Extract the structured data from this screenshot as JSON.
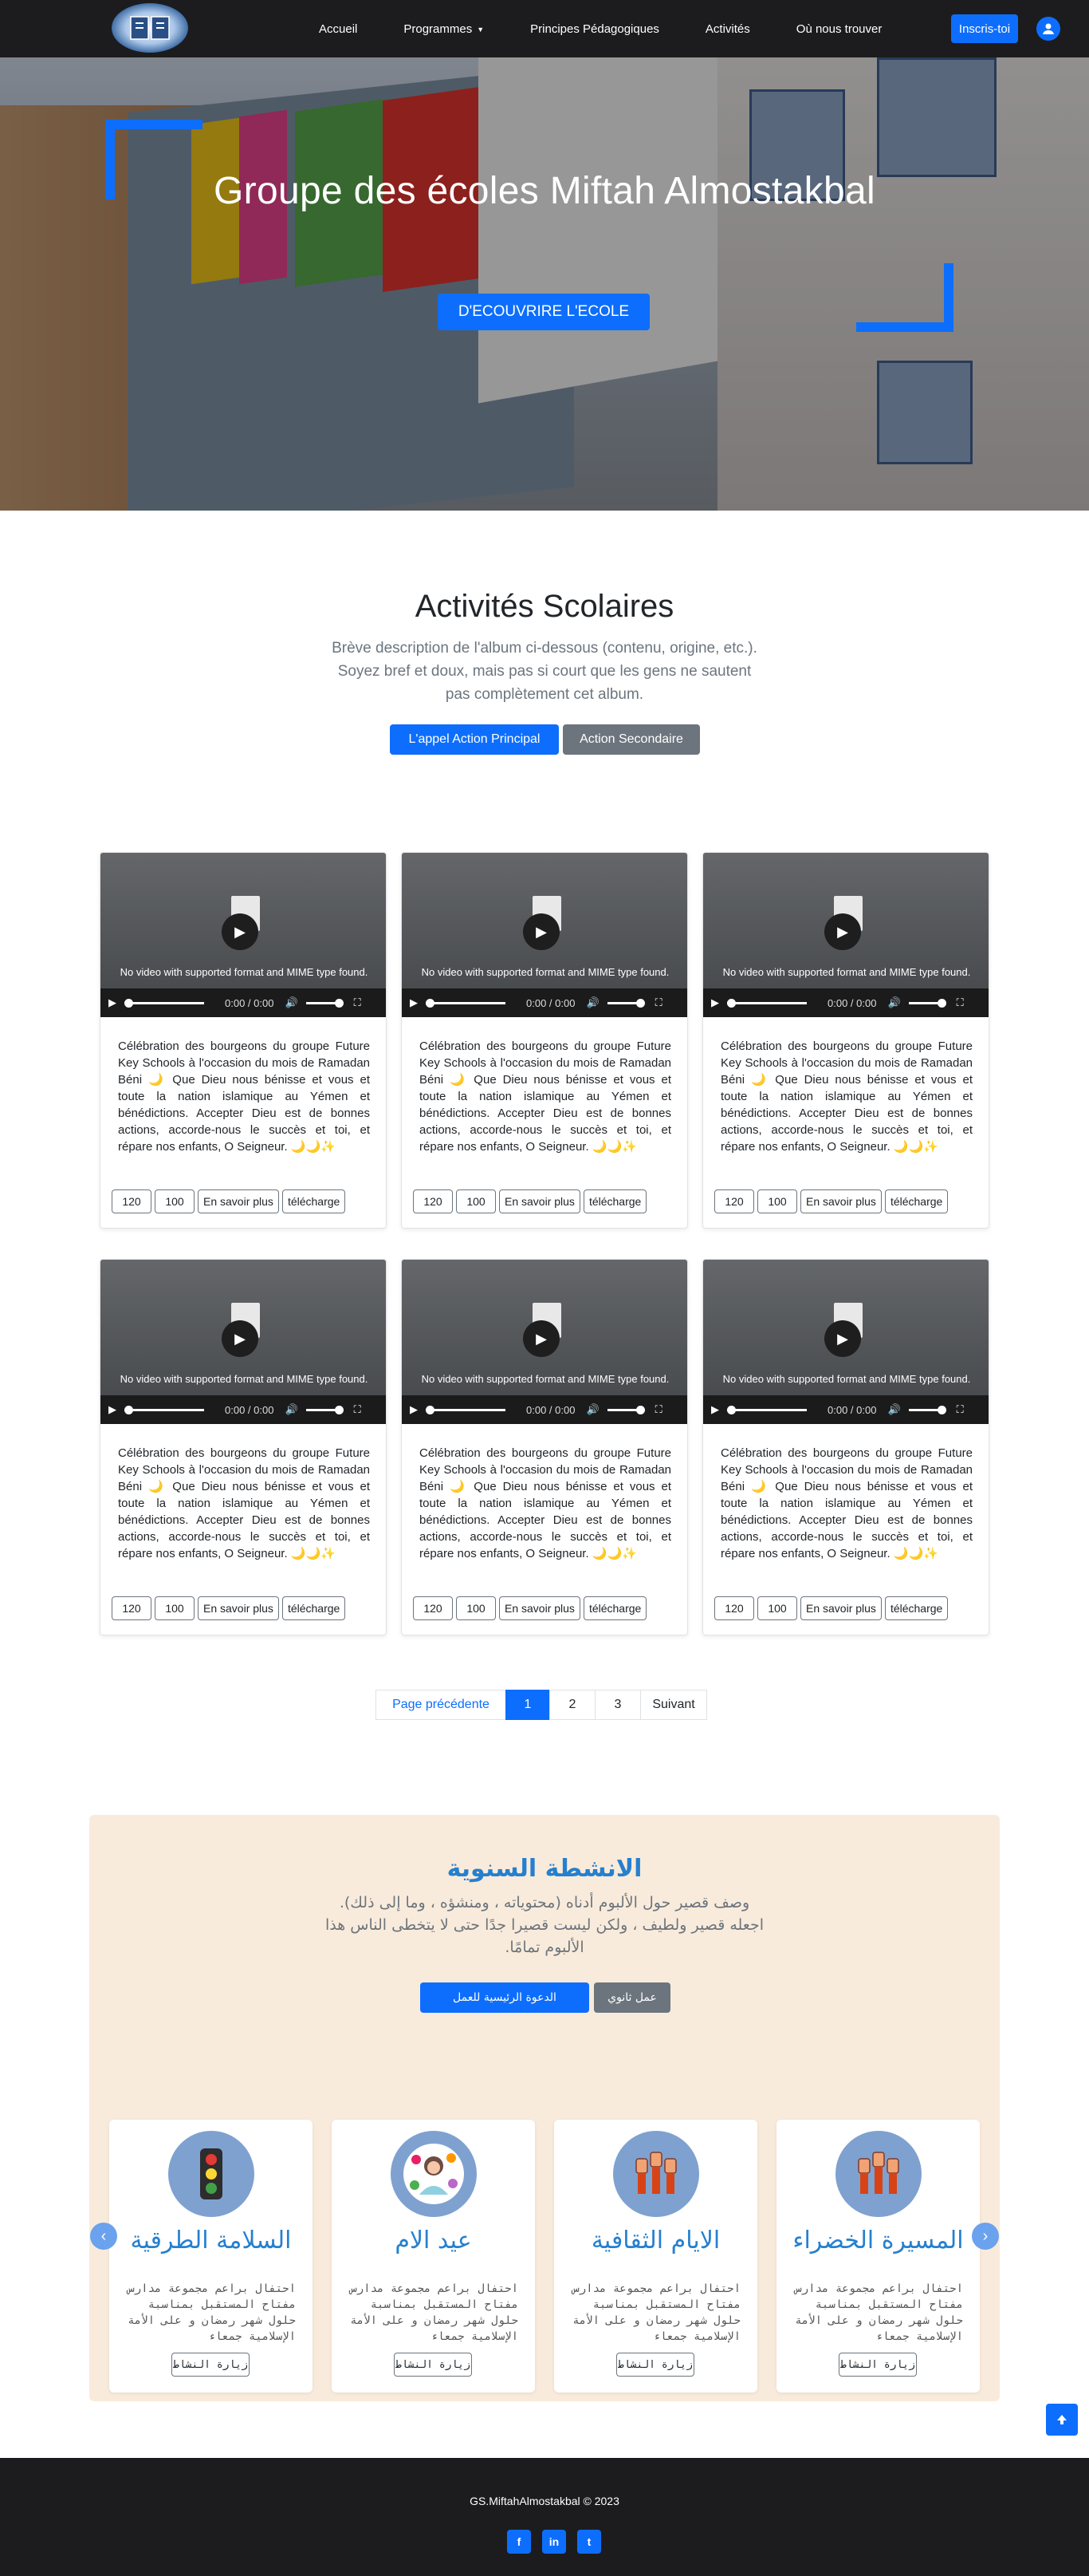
{
  "nav": {
    "items": [
      {
        "label": "Accueil"
      },
      {
        "label": "Programmes"
      },
      {
        "label": "Principes Pédagogiques"
      },
      {
        "label": "Activités"
      },
      {
        "label": "Où nous trouver"
      }
    ],
    "signup_label": "Inscris-toi",
    "logo_icon": "school-logo",
    "user_icon": "user-icon"
  },
  "hero": {
    "title": "Groupe des écoles Miftah Almostakbal",
    "cta_label": "D'ECOUVRIRE L'ECOLE"
  },
  "activities": {
    "title": "Activités Scolaires",
    "description": "Brève description de l'album ci-dessous (contenu, origine, etc.). Soyez bref et doux, mais pas si court que les gens ne sautent pas complètement cet album.",
    "primary_label": "L'appel Action Principal",
    "secondary_label": "Action Secondaire"
  },
  "video": {
    "unsupported_message": "No video with supported format and MIME type found.",
    "time": "0:00 / 0:00"
  },
  "cards": [
    {
      "text": "Célébration des bourgeons du groupe Future Key Schools à l'occasion du mois de Ramadan Béni 🌙 Que Dieu nous bénisse et vous et toute la nation islamique au Yémen et bénédictions. Accepter Dieu est de bonnes actions, accorde-nous le succès et toi, et répare nos enfants, O Seigneur. 🌙🌙✨",
      "views": "120",
      "likes": "100",
      "more_label": "En savoir plus",
      "download_label": "télécharge"
    },
    {
      "text": "Célébration des bourgeons du groupe Future Key Schools à l'occasion du mois de Ramadan Béni 🌙 Que Dieu nous bénisse et vous et toute la nation islamique au Yémen et bénédictions. Accepter Dieu est de bonnes actions, accorde-nous le succès et toi, et répare nos enfants, O Seigneur. 🌙🌙✨",
      "views": "120",
      "likes": "100",
      "more_label": "En savoir plus",
      "download_label": "télécharge"
    },
    {
      "text": "Célébration des bourgeons du groupe Future Key Schools à l'occasion du mois de Ramadan Béni 🌙 Que Dieu nous bénisse et vous et toute la nation islamique au Yémen et bénédictions. Accepter Dieu est de bonnes actions, accorde-nous le succès et toi, et répare nos enfants, O Seigneur. 🌙🌙✨",
      "views": "120",
      "likes": "100",
      "more_label": "En savoir plus",
      "download_label": "télécharge"
    },
    {
      "text": "Célébration des bourgeons du groupe Future Key Schools à l'occasion du mois de Ramadan Béni 🌙 Que Dieu nous bénisse et vous et toute la nation islamique au Yémen et bénédictions. Accepter Dieu est de bonnes actions, accorde-nous le succès et toi, et répare nos enfants, O Seigneur. 🌙🌙✨",
      "views": "120",
      "likes": "100",
      "more_label": "En savoir plus",
      "download_label": "télécharge"
    },
    {
      "text": "Célébration des bourgeons du groupe Future Key Schools à l'occasion du mois de Ramadan Béni 🌙 Que Dieu nous bénisse et vous et toute la nation islamique au Yémen et bénédictions. Accepter Dieu est de bonnes actions, accorde-nous le succès et toi, et répare nos enfants, O Seigneur. 🌙🌙✨",
      "views": "120",
      "likes": "100",
      "more_label": "En savoir plus",
      "download_label": "télécharge"
    },
    {
      "text": "Célébration des bourgeons du groupe Future Key Schools à l'occasion du mois de Ramadan Béni 🌙 Que Dieu nous bénisse et vous et toute la nation islamique au Yémen et bénédictions. Accepter Dieu est de bonnes actions, accorde-nous le succès et toi, et répare nos enfants, O Seigneur. 🌙🌙✨",
      "views": "120",
      "likes": "100",
      "more_label": "En savoir plus",
      "download_label": "télécharge"
    }
  ],
  "pagination": {
    "prev_label": "Page précédente",
    "pages": [
      "1",
      "2",
      "3"
    ],
    "current": "1",
    "next_label": "Suivant"
  },
  "arabic": {
    "title": "الانشطة السنوية",
    "description": "وصف قصير حول الألبوم أدناه (محتوياته ، ومنشؤه ، وما إلى ذلك). اجعله قصير ولطيف ، ولكن ليست قصيرا جدًا حتى لا يتخطى الناس هذا الألبوم تمامًا.",
    "primary_label": "الدعوة الرئيسية للعمل",
    "secondary_label": "عمل ثانوي",
    "cards": [
      {
        "title": "السلامة الطرقية",
        "text": "احتفال براعم مجموعة مدارس مفتاح المستقبل بمناسبة حلول شهر رمضان و على الأمة الإسلامية جمعاء",
        "button": "زيارة النشاط",
        "icon": "traffic-light-icon"
      },
      {
        "title": "عيد الام",
        "text": "احتفال براعم مجموعة مدارس مفتاح المستقبل بمناسبة حلول شهر رمضان و على الأمة الإسلامية جمعاء",
        "button": "زيارة النشاط",
        "icon": "mother-flowers-icon"
      },
      {
        "title": "الايام الثقافية",
        "text": "احتفال براعم مجموعة مدارس مفتاح المستقبل بمناسبة حلول شهر رمضان و على الأمة الإسلامية جمعاء",
        "button": "زيارة النشاط",
        "icon": "raised-fists-icon"
      },
      {
        "title": "المسيرة الخضراء",
        "text": "احتفال براعم مجموعة مدارس مفتاح المستقبل بمناسبة حلول شهر رمضان و على الأمة الإسلامية جمعاء",
        "button": "زيارة النشاط",
        "icon": "raised-fists-icon"
      }
    ]
  },
  "footer": {
    "copyright": "GS.MiftahAlmostakbal © 2023",
    "social": [
      {
        "icon": "facebook-icon",
        "label": "f"
      },
      {
        "icon": "linkedin-icon",
        "label": "in"
      },
      {
        "icon": "twitter-icon",
        "label": "t"
      }
    ]
  },
  "colors": {
    "primary": "#0d6efd",
    "secondary": "#6c757d",
    "navbar": "#1c1c1e",
    "arabic_panel": "#f9ebdb",
    "arabic_title": "#2580cf"
  }
}
